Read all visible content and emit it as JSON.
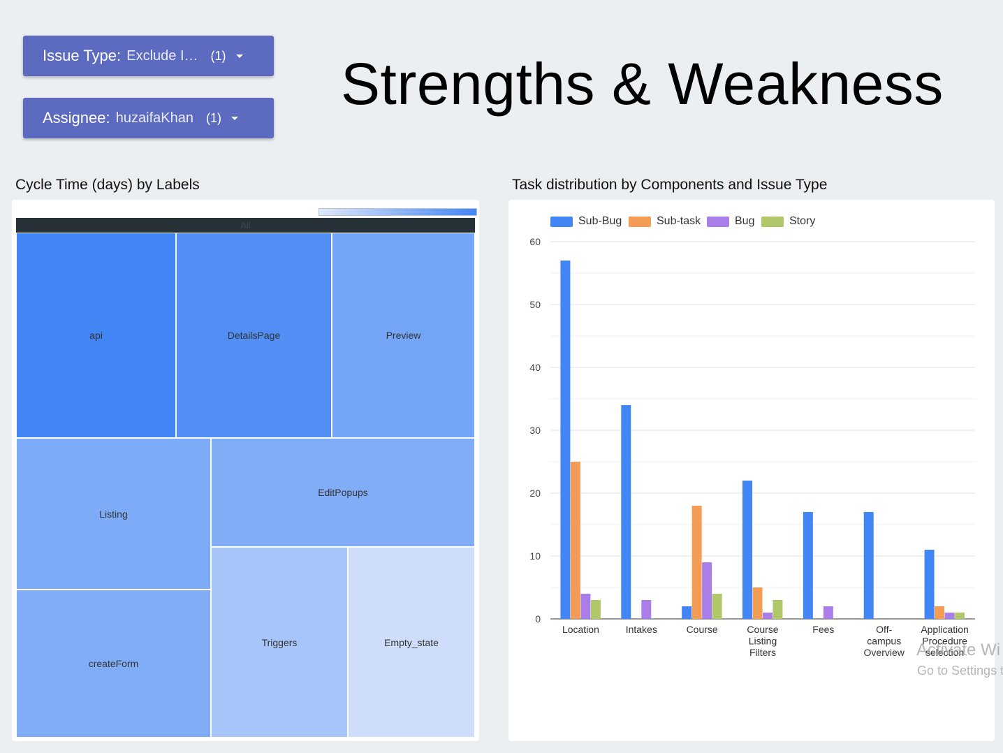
{
  "filters": [
    {
      "name": "Issue Type",
      "value": "Exclude I…",
      "count": "(1)"
    },
    {
      "name": "Assignee",
      "value": "huzaifaKhan",
      "count": "(1)"
    }
  ],
  "page_title": "Strengths & Weakness",
  "treemap": {
    "title": "Cycle Time (days) by Labels",
    "root_label": "All",
    "colors": {
      "min": "#e0e9fb",
      "max": "#4285f4",
      "header": "#263238"
    }
  },
  "barchart": {
    "title": "Task distribution by Components and Issue Type"
  },
  "watermark": {
    "line1": "Activate Wi",
    "line2": "Go to Settings t"
  },
  "chart_data": [
    {
      "type": "treemap",
      "title": "Cycle Time (days) by Labels",
      "root": "All",
      "items": [
        {
          "label": "api",
          "color_level": 1.0
        },
        {
          "label": "DetailsPage",
          "color_level": 0.9
        },
        {
          "label": "Preview",
          "color_level": 0.68
        },
        {
          "label": "Listing",
          "color_level": 0.62
        },
        {
          "label": "EditPopups",
          "color_level": 0.6
        },
        {
          "label": "createForm",
          "color_level": 0.6
        },
        {
          "label": "Triggers",
          "color_level": 0.36
        },
        {
          "label": "Empty_state",
          "color_level": 0.12
        }
      ]
    },
    {
      "type": "bar",
      "title": "Task distribution by Components and Issue Type",
      "categories": [
        [
          "Location"
        ],
        [
          "Intakes"
        ],
        [
          "Course"
        ],
        [
          "Course",
          "Listing",
          "Filters"
        ],
        [
          "Fees"
        ],
        [
          "Off-",
          "campus",
          "Overview"
        ],
        [
          "Application",
          "Procedure",
          "selection"
        ]
      ],
      "series": [
        {
          "name": "Sub-Bug",
          "color": "#4285f4",
          "values": [
            57,
            34,
            2,
            22,
            17,
            17,
            11
          ]
        },
        {
          "name": "Sub-task",
          "color": "#f39c55",
          "values": [
            25,
            0,
            18,
            5,
            0,
            0,
            2
          ]
        },
        {
          "name": "Bug",
          "color": "#a97ee8",
          "values": [
            4,
            3,
            9,
            1,
            2,
            0,
            1
          ]
        },
        {
          "name": "Story",
          "color": "#b1c86a",
          "values": [
            3,
            0,
            4,
            3,
            0,
            0,
            1
          ]
        }
      ],
      "ylim": [
        0,
        60
      ],
      "yticks": [
        0,
        10,
        20,
        30,
        40,
        50,
        60
      ],
      "grid": true,
      "legend": "top-left"
    }
  ]
}
